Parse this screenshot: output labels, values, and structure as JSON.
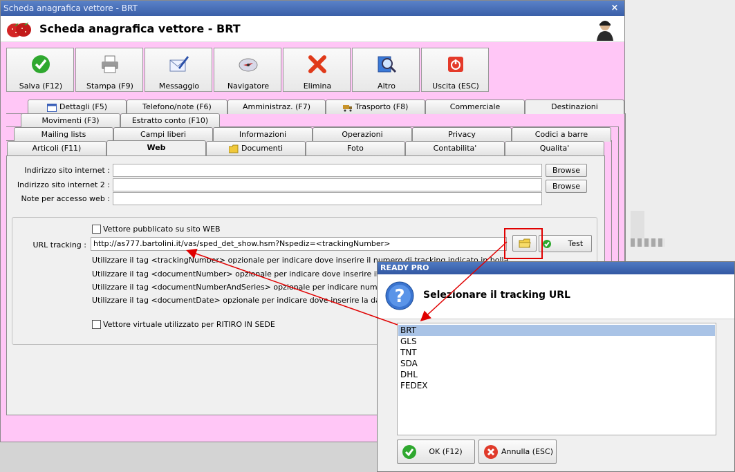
{
  "main_window": {
    "title": "Scheda anagrafica vettore - BRT",
    "header_title": "Scheda anagrafica vettore - BRT",
    "close_glyph": "×"
  },
  "toolbar": [
    {
      "label": "Salva (F12)",
      "icon": "check-icon"
    },
    {
      "label": "Stampa (F9)",
      "icon": "printer-icon"
    },
    {
      "label": "Messaggio",
      "icon": "envelope-pen-icon"
    },
    {
      "label": "Navigatore",
      "icon": "compass-icon"
    },
    {
      "label": "Elimina",
      "icon": "red-x-icon"
    },
    {
      "label": "Altro",
      "icon": "magnifier-book-icon"
    },
    {
      "label": "Uscita (ESC)",
      "icon": "power-icon"
    }
  ],
  "tabs": {
    "row1": [
      "Dettagli (F5)",
      "Telefono/note (F6)",
      "Amministraz. (F7)",
      "Trasporto (F8)",
      "Commerciale",
      "Destinazioni"
    ],
    "row2": [
      "Movimenti (F3)",
      "Estratto conto (F10)"
    ],
    "row3": [
      "Mailing lists",
      "Campi liberi",
      "Informazioni",
      "Operazioni",
      "Privacy",
      "Codici a barre"
    ],
    "row4": [
      "Articoli (F11)",
      "Web",
      "Documenti",
      "Foto",
      "Contabilita'",
      "Qualita'"
    ],
    "active": "Web"
  },
  "form": {
    "site_label": "Indirizzo sito internet :",
    "site_value": "",
    "site2_label": "Indirizzo sito internet 2 :",
    "site2_value": "",
    "notes_label": "Note per accesso web :",
    "notes_value": "",
    "browse_label": "Browse",
    "published_label": "Vettore pubblicato su sito WEB",
    "published_checked": false,
    "url_label": "URL tracking :",
    "url_value": "http://as777.bartolini.it/vas/sped_det_show.hsm?Nspediz=<trackingNumber>",
    "test_label": "Test",
    "hints": [
      "Utilizzare il tag <trackingNumber> opzionale per indicare dove inserire il numero di tracking indicato in bolla",
      "Utilizzare il tag <documentNumber> opzionale per indicare dove inserire il numero del c",
      "Utilizzare il tag <documentNumberAndSeries> opzionale per indicare numero e serie de",
      "Utilizzare il tag <documentDate> opzionale per indicare dove inserire la data del docum"
    ],
    "virtual_label": "Vettore virtuale utilizzato per RITIRO IN SEDE",
    "virtual_checked": false
  },
  "dialog": {
    "title": "READY PRO",
    "message": "Selezionare il tracking URL",
    "items": [
      "BRT",
      "GLS",
      "TNT",
      "SDA",
      "DHL",
      "FEDEX"
    ],
    "selected": "BRT",
    "ok_label": "OK (F12)",
    "cancel_label": "Annulla (ESC)"
  },
  "colors": {
    "window_bg": "#ffc6f6",
    "annotation": "#e00000",
    "selection": "#a9c3e6"
  }
}
